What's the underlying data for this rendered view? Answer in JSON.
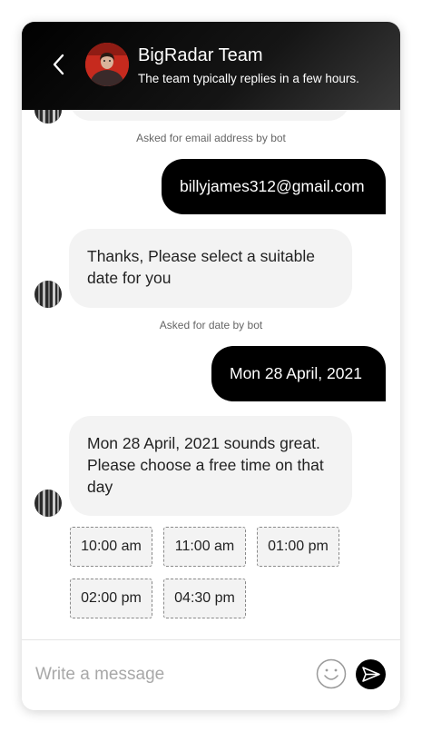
{
  "header": {
    "title": "BigRadar Team",
    "subtitle": "The team typically replies in a few hours.",
    "back_icon": "chevron-left-icon",
    "avatar_colors": {
      "background": "#c62a1e"
    }
  },
  "messages": {
    "note_email": "Asked for email address by bot",
    "user_email": "billyjames312@gmail.com",
    "bot_select_date": "Thanks, Please select a suitable date for you",
    "note_date": "Asked for date by bot",
    "user_date": "Mon 28 April, 2021",
    "bot_choose_time": "Mon 28 April, 2021 sounds great. Please choose a free time on that day",
    "time_slots": [
      "10:00 am",
      "11:00 am",
      "01:00 pm",
      "02:00 pm",
      "04:30 pm"
    ]
  },
  "composer": {
    "placeholder": "Write a message",
    "value": "",
    "emoji_icon": "smiley-icon",
    "send_icon": "send-icon"
  },
  "colors": {
    "user_bubble": "#000000",
    "bot_bubble": "#f3f3f3",
    "header": "#000000"
  }
}
